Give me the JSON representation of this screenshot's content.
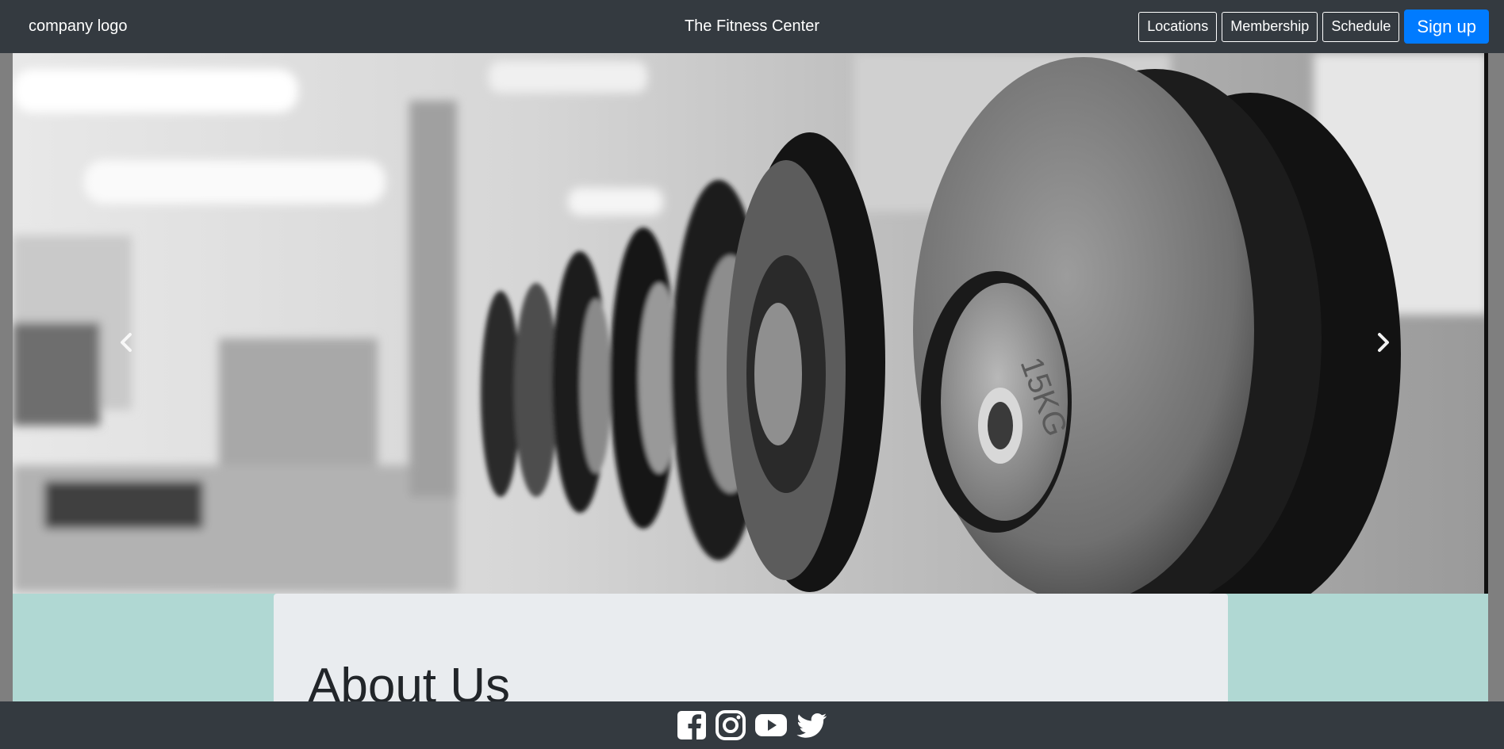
{
  "navbar": {
    "brand": "company logo",
    "title": "The Fitness Center",
    "links": [
      "Locations",
      "Membership",
      "Schedule"
    ],
    "signup_label": "Sign up"
  },
  "carousel": {
    "prev_icon": "chevron-left-icon",
    "next_icon": "chevron-right-icon",
    "plate_marking": "15KG"
  },
  "about": {
    "heading": "About Us"
  },
  "footer": {
    "icons": [
      "facebook-icon",
      "instagram-icon",
      "youtube-icon",
      "twitter-icon"
    ]
  },
  "colors": {
    "navbar_bg": "#343a40",
    "signup_bg": "#007bff",
    "teal_band": "#b0d8d3",
    "card_bg": "#e9ecef",
    "side_margin": "#7f7f7f"
  }
}
